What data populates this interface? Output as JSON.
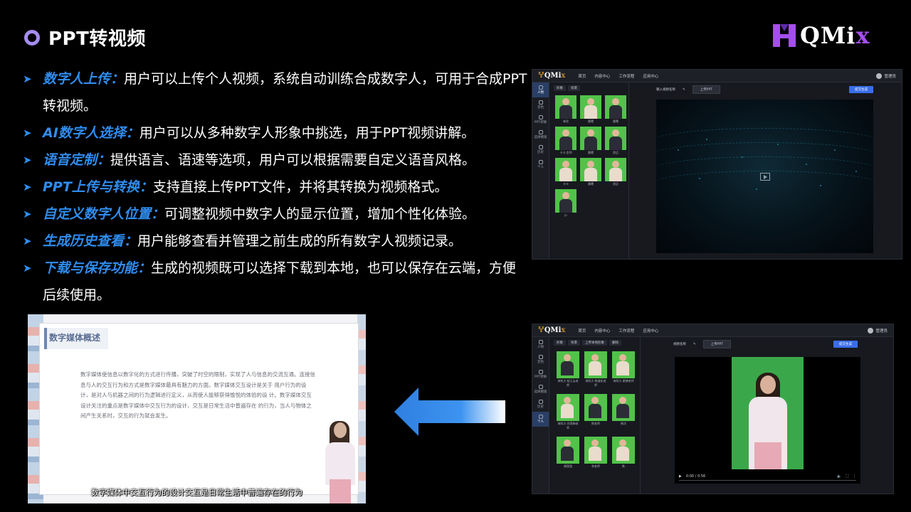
{
  "header": {
    "title": "PPT转视频",
    "logo_main": "QMi",
    "logo_accent": "x"
  },
  "bullets": [
    {
      "key": "数字人上传：",
      "text": "用户可以上传个人视频，系统自动训练合成数字人，可用于合成PPT转视频。"
    },
    {
      "key": "AI数字人选择：",
      "text": "用户可以从多种数字人形象中挑选，用于PPT视频讲解。"
    },
    {
      "key": "语音定制：",
      "text": "提供语言、语速等选项，用户可以根据需要自定义语音风格。"
    },
    {
      "key": "PPT上传与转换：",
      "text": "支持直接上传PPT文件，并将其转换为视频格式。"
    },
    {
      "key": "自定义数字人位置：",
      "text": "可调整视频中数字人的显示位置，增加个性化体验。"
    },
    {
      "key": "生成历史查看：",
      "text": "用户能够查看并管理之前生成的所有数字人视频记录。"
    },
    {
      "key": "下载与保存功能：",
      "text": "生成的视频既可以选择下载到本地，也可以保存在云端，方便后续使用。"
    }
  ],
  "app": {
    "logo_main": "QMi",
    "logo_accent": "x",
    "nav": [
      "首页",
      "内容中心",
      "工作流程",
      "应用中心"
    ],
    "user": "管理员",
    "sidebar": [
      "人物",
      "音色",
      "PPT转换",
      "选择模版",
      "历史",
      "个人"
    ],
    "panel_tabs": [
      "形象",
      "背景"
    ],
    "input_label": "输入视频名称",
    "upload_label": "上传PPT",
    "generate_label": "提交生成",
    "s2_input_label": "视频名称",
    "s2_panel_tabs": [
      "形象",
      "背景",
      "上传本地形象",
      "删除"
    ],
    "video_time": "0:00 / 0:56",
    "s1_names": [
      "林欣",
      "晨曦",
      "晨曦",
      "卡卡·女师",
      "晨曦",
      "思迈",
      "卡卡",
      "晨曦",
      "思迈",
      "jn"
    ],
    "s2_names": [
      "海科大·祝王云老师",
      "海科大·杨道拓老师",
      "海科大·谢博老师",
      "海科大·邓燕梅老师",
      "陈老师",
      "杨洋",
      "谢国强",
      "李老师",
      "陈"
    ]
  },
  "slide": {
    "heading": "数字媒体概述",
    "paragraph": "数字媒体使信息以数字化的方式进行传播，突破了时空的限制，实现了人与信息的交流互通。连接信息与人的交互行为和方式是数字媒体最具有魅力的方面。数字媒体交互设计是关于 用户行为的设计，是对人与机器之间的行为逻辑进行定义，从而使人能够获得愉悦的体验的设 计。数字媒体交互设计关注的重点是数字媒体中交互行为的设计，交互是日常生活中普遍存在 的行为，当人与物体之间产生关系时，交互的行为就会发生。",
    "caption": "数字媒体中交互行为的设计交互是日常生活中普遍存在的行为"
  },
  "colors": {
    "accent_blue": "#2f8df0",
    "title_dot": "#a58cf0",
    "logo_purple": "#a44ef0",
    "arrow_blue": "#2f7fe0"
  }
}
